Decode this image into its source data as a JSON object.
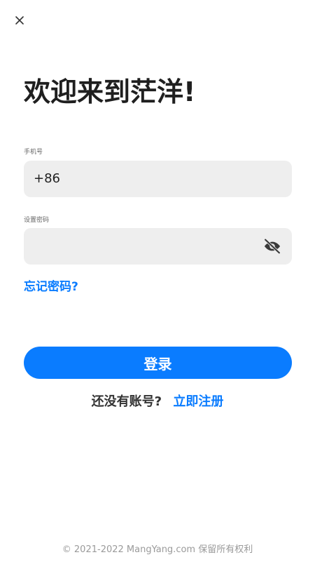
{
  "header": {
    "close_icon": "close-icon",
    "title": "欢迎来到茫洋!"
  },
  "form": {
    "phone": {
      "label": "手机号",
      "prefix": "+86",
      "value": "",
      "placeholder": ""
    },
    "password": {
      "label": "设置密码",
      "value": "",
      "placeholder": "",
      "toggle_icon": "eye-off-icon"
    },
    "forgot_label": "忘记密码?",
    "login_label": "登录"
  },
  "register": {
    "question": "还没有账号?",
    "link_label": "立即注册"
  },
  "footer": {
    "copyright": "© 2021-2022 MangYang.com 保留所有权利"
  },
  "colors": {
    "accent": "#0a7cff",
    "field_background": "#eeeeee",
    "text_primary": "#1f1f1f",
    "footer_text": "#9a9a9a"
  }
}
